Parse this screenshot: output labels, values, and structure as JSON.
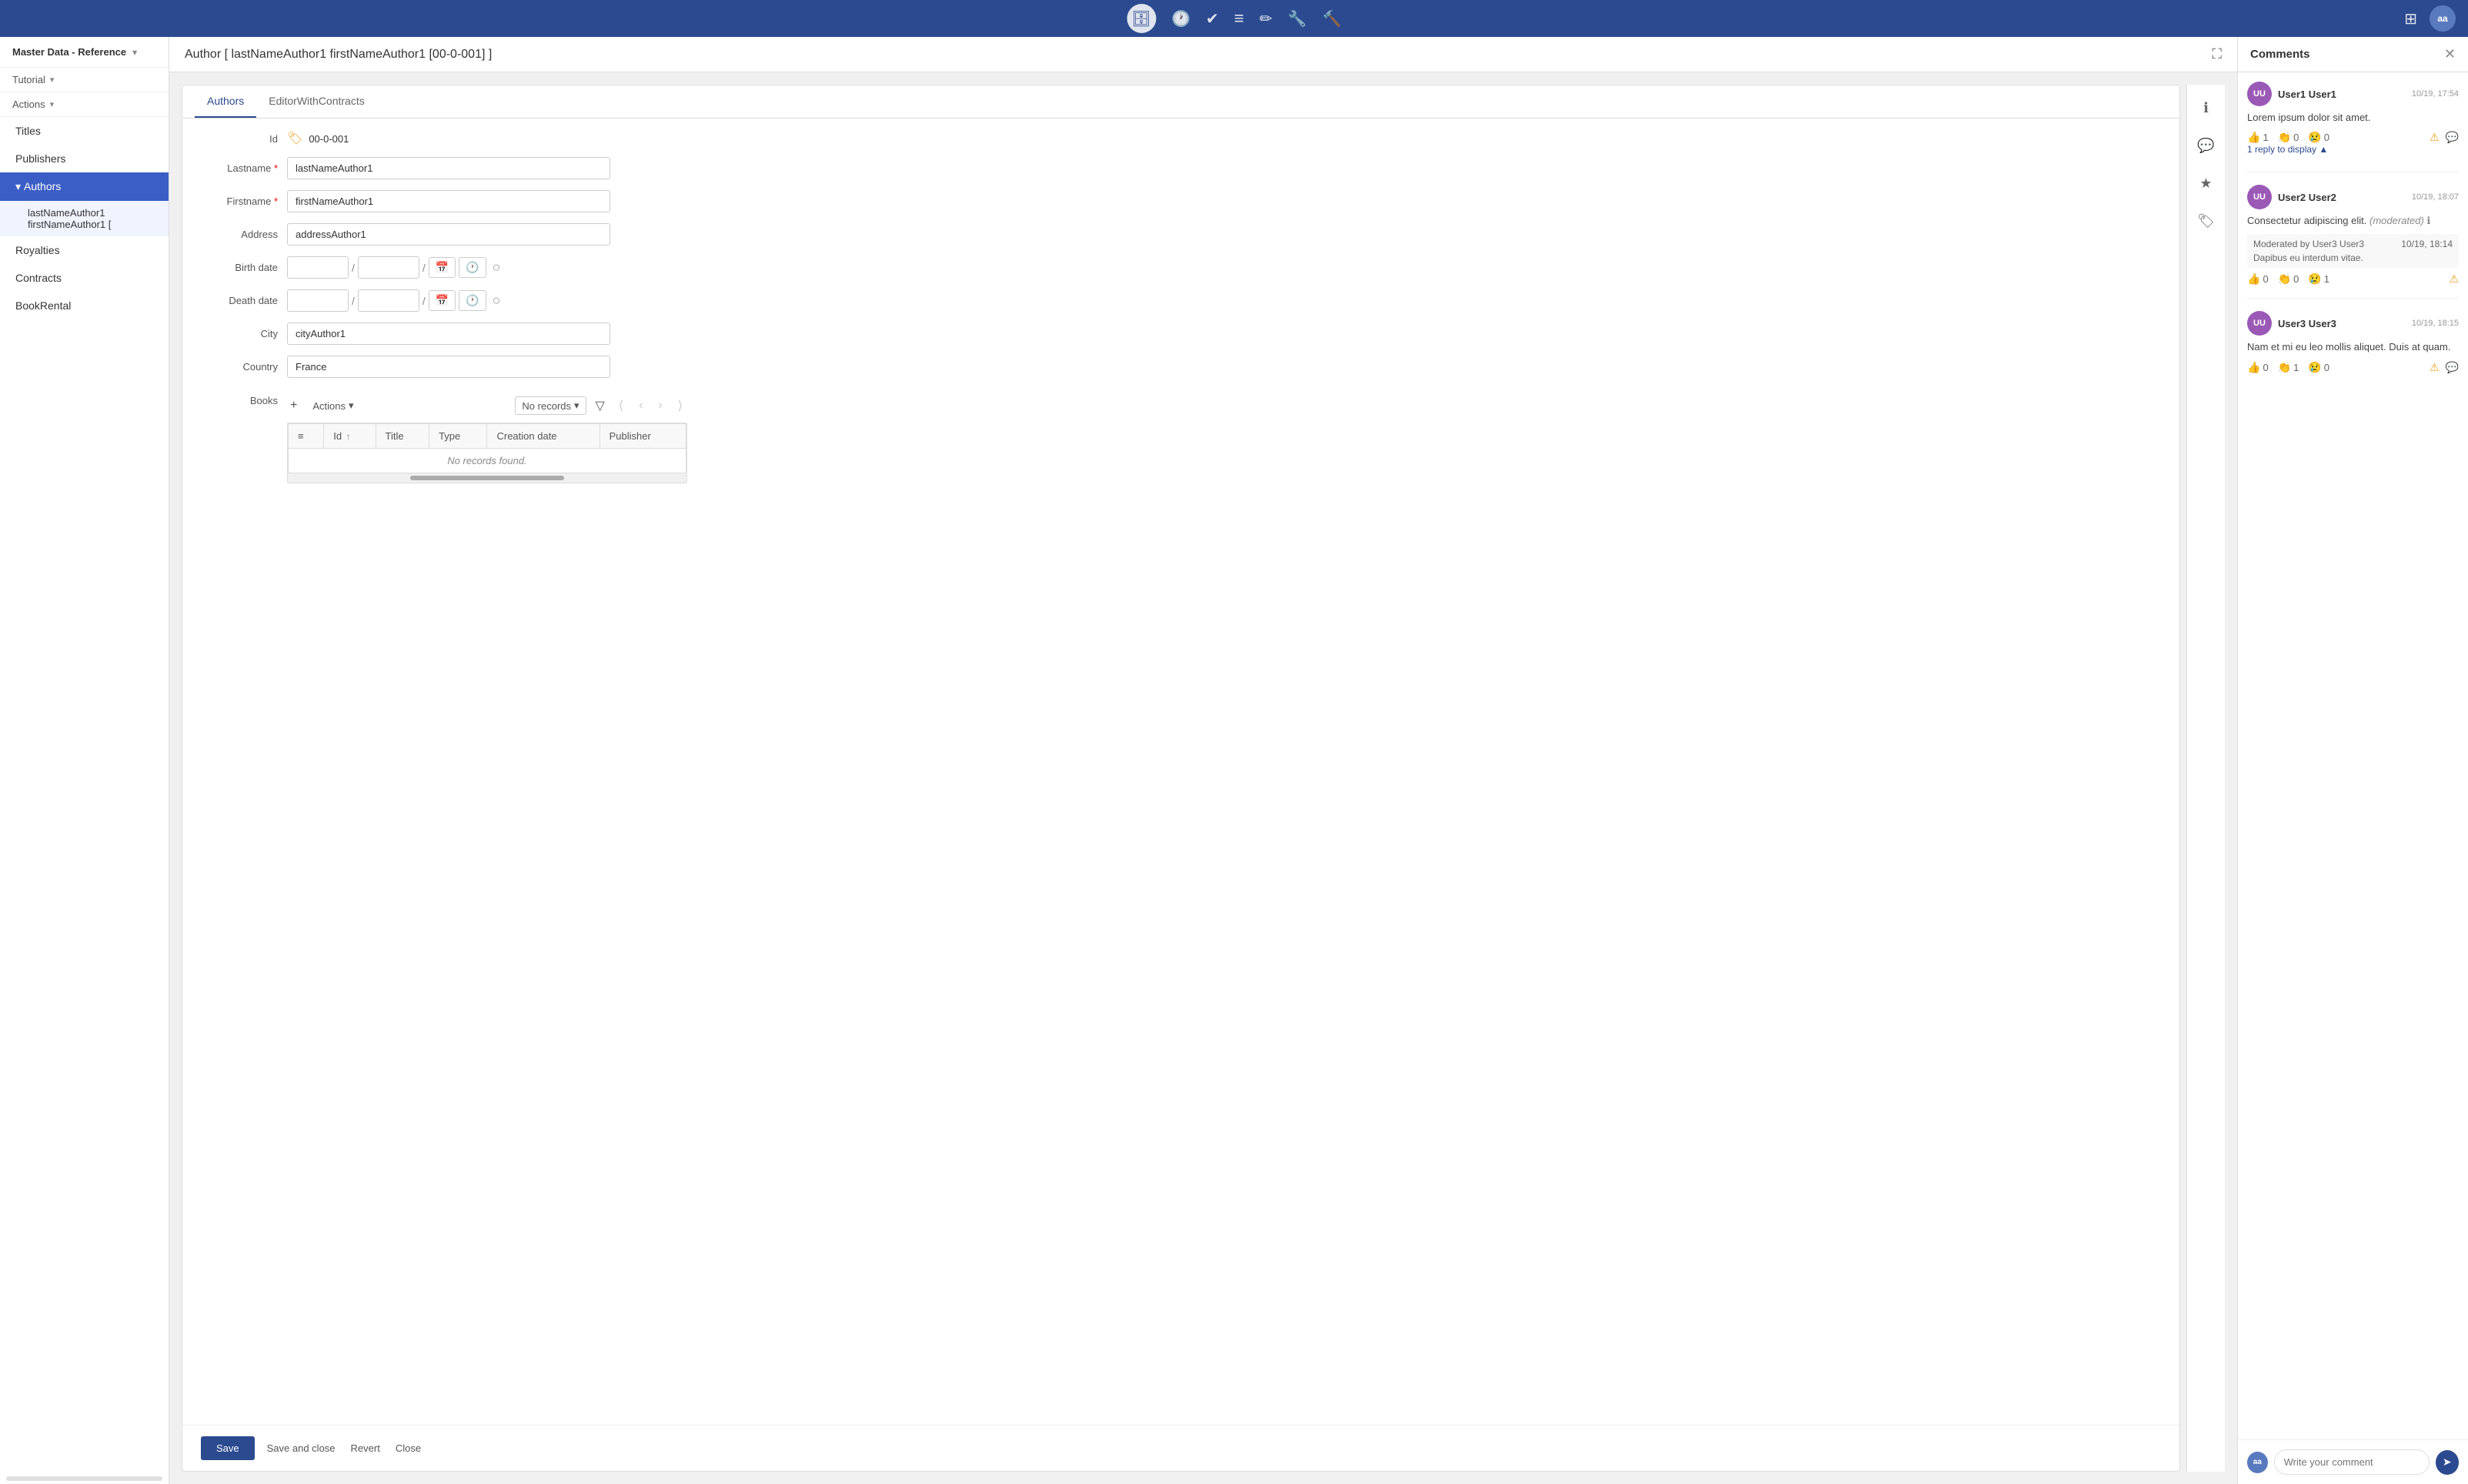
{
  "topbar": {
    "icons": [
      {
        "name": "database-icon",
        "symbol": "🗄",
        "active": true
      },
      {
        "name": "clock-icon",
        "symbol": "🕐",
        "active": false
      },
      {
        "name": "checkbox-icon",
        "symbol": "✅",
        "active": false
      },
      {
        "name": "layers-icon",
        "symbol": "≡",
        "active": false
      },
      {
        "name": "edit-icon",
        "symbol": "✏",
        "active": false
      },
      {
        "name": "wrench-icon",
        "symbol": "🔧",
        "active": false
      },
      {
        "name": "settings-icon",
        "symbol": "🔨",
        "active": false
      }
    ],
    "right_icon": "⊞",
    "avatar_label": "aa"
  },
  "sidebar": {
    "header_title": "Master Data - Reference",
    "dropdown_icon": "▾",
    "tutorial_label": "Tutorial",
    "tutorial_arrow": "▾",
    "actions_label": "Actions",
    "actions_arrow": "▾",
    "nav_items": [
      {
        "label": "Titles",
        "active": false,
        "id": "titles"
      },
      {
        "label": "Publishers",
        "active": false,
        "id": "publishers"
      },
      {
        "label": "Authors",
        "active": true,
        "id": "authors"
      },
      {
        "label": "Royalties",
        "active": false,
        "id": "royalties"
      },
      {
        "label": "Contracts",
        "active": false,
        "id": "contracts"
      },
      {
        "label": "BookRental",
        "active": false,
        "id": "bookrental"
      }
    ],
    "sub_item_label": "lastNameAuthor1 firstNameAuthor1 ["
  },
  "content": {
    "title": "Author [ lastNameAuthor1 firstNameAuthor1 [00-0-001] ]",
    "fullscreen_btn": "⛶"
  },
  "form": {
    "tabs": [
      {
        "label": "Authors",
        "active": true
      },
      {
        "label": "EditorWithContracts",
        "active": false
      }
    ],
    "fields": {
      "id_label": "Id",
      "id_value": "00-0-001",
      "id_icon": "🏷",
      "lastname_label": "Lastname",
      "lastname_value": "lastNameAuthor1",
      "firstname_label": "Firstname",
      "firstname_value": "firstNameAuthor1",
      "address_label": "Address",
      "address_value": "addressAuthor1",
      "birthdate_label": "Birth date",
      "birthdate_value": "/ /",
      "deathdate_label": "Death date",
      "deathdate_value": "/ /",
      "city_label": "City",
      "city_value": "cityAuthor1",
      "country_label": "Country",
      "country_value": "France",
      "books_label": "Books"
    },
    "books_table": {
      "toolbar": {
        "add_btn": "+",
        "actions_label": "Actions",
        "actions_arrow": "▾",
        "records_label": "No records",
        "records_arrow": "▾",
        "filter_icon": "⊿",
        "nav_first": "⟨",
        "nav_prev": "‹",
        "nav_next": "›",
        "nav_last": "⟩"
      },
      "columns": [
        {
          "label": "≡",
          "id": "drag"
        },
        {
          "label": "Id",
          "id": "id",
          "sort": "↑"
        },
        {
          "label": "Title",
          "id": "title"
        },
        {
          "label": "Type",
          "id": "type"
        },
        {
          "label": "Creation date",
          "id": "creation_date"
        },
        {
          "label": "Publisher",
          "id": "publisher"
        }
      ],
      "no_records_text": "No records found."
    },
    "footer": {
      "save_label": "Save",
      "save_close_label": "Save and close",
      "revert_label": "Revert",
      "close_label": "Close"
    }
  },
  "right_icons": [
    {
      "name": "info-icon",
      "symbol": "ℹ"
    },
    {
      "name": "comment-icon",
      "symbol": "💬"
    },
    {
      "name": "star-icon",
      "symbol": "★"
    },
    {
      "name": "tag-icon",
      "symbol": "🏷"
    }
  ],
  "comments": {
    "title": "Comments",
    "close_icon": "✕",
    "items": [
      {
        "id": "comment1",
        "avatar": "UU",
        "user": "User1 User1",
        "time": "10/19, 17:54",
        "text": "Lorem ipsum dolor sit amet.",
        "reactions": [
          {
            "icon": "👍",
            "label": "1"
          },
          {
            "icon": "👏",
            "label": "0"
          },
          {
            "icon": "😢",
            "label": "0"
          }
        ],
        "reply_count": "1 reply to display ▲",
        "replies": [],
        "has_alert": true,
        "has_reply": true
      },
      {
        "id": "comment2",
        "avatar": "UU",
        "user": "User2 User2",
        "time": "10/19, 18:07",
        "text": "Consectetur adipiscing elit.",
        "moderated": true,
        "moderated_text": "(moderated)",
        "moderation_info": "Moderated by User3 User3",
        "moderation_time": "10/19, 18:14",
        "moderation_reply": "Dapibus eu interdum vitae.",
        "info_icon": "ℹ",
        "reactions": [
          {
            "icon": "👍",
            "label": "0"
          },
          {
            "icon": "👏",
            "label": "0"
          },
          {
            "icon": "😢",
            "label": "1"
          }
        ],
        "has_alert": true
      },
      {
        "id": "comment3",
        "avatar": "UU",
        "user": "User3 User3",
        "time": "10/19, 18:15",
        "text": "Nam et mi eu leo mollis aliquet. Duis at quam.",
        "reactions": [
          {
            "icon": "👍",
            "label": "0"
          },
          {
            "icon": "👏",
            "label": "1"
          },
          {
            "icon": "😢",
            "label": "0"
          }
        ],
        "has_alert": true,
        "has_reply": true
      }
    ],
    "input_placeholder": "Write your comment",
    "send_icon": "➤",
    "input_avatar": "aa"
  }
}
